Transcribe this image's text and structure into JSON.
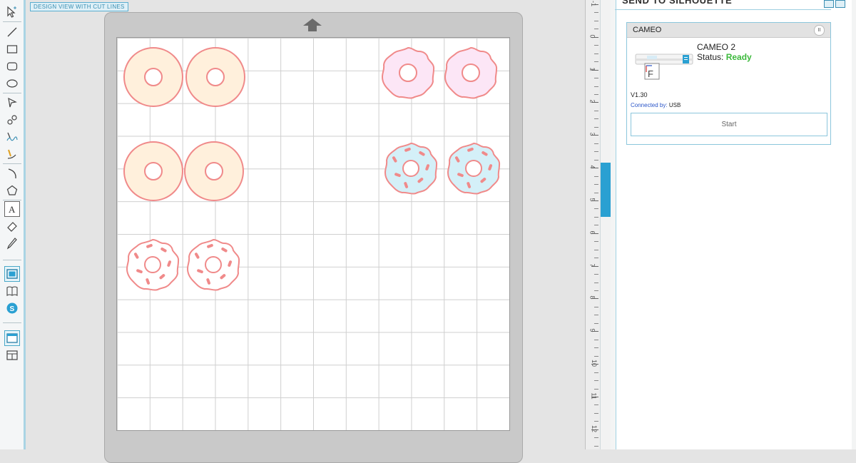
{
  "canvas": {
    "view_label": "DESIGN VIEW WITH CUT LINES"
  },
  "ruler": {
    "labels": [
      "-1",
      "0",
      "1",
      "2",
      "3",
      "4",
      "5",
      "6",
      "7",
      "8",
      "9",
      "10",
      "11",
      "12"
    ]
  },
  "panel": {
    "title": "SEND TO SILHOUETTE",
    "device": {
      "header": "CAMEO",
      "name": "CAMEO 2",
      "status_label": "Status:",
      "status_value": "Ready",
      "firmware": "V1.30",
      "connected_label": "Connected by:",
      "connected_value": "USB",
      "start_label": "Start"
    }
  },
  "colors": {
    "accent": "#2aa0d2",
    "cut_line": "#f08a8a",
    "cream_fill": "#fff0dc",
    "pink_fill": "#fce6f6",
    "blue_fill": "#d4f0f8",
    "status_ready": "#3cb93c"
  },
  "icons": [
    "select-icon",
    "line-icon",
    "rectangle-icon",
    "rounded-rectangle-icon",
    "ellipse-icon",
    "polygon-icon",
    "curve-icon",
    "freehand-icon",
    "smooth-freehand-icon",
    "arc-icon",
    "regular-polygon-icon",
    "text-icon",
    "eraser-icon",
    "knife-icon",
    "design-view-icon",
    "library-icon",
    "store-icon",
    "send-panel-icon",
    "split-view-icon"
  ]
}
